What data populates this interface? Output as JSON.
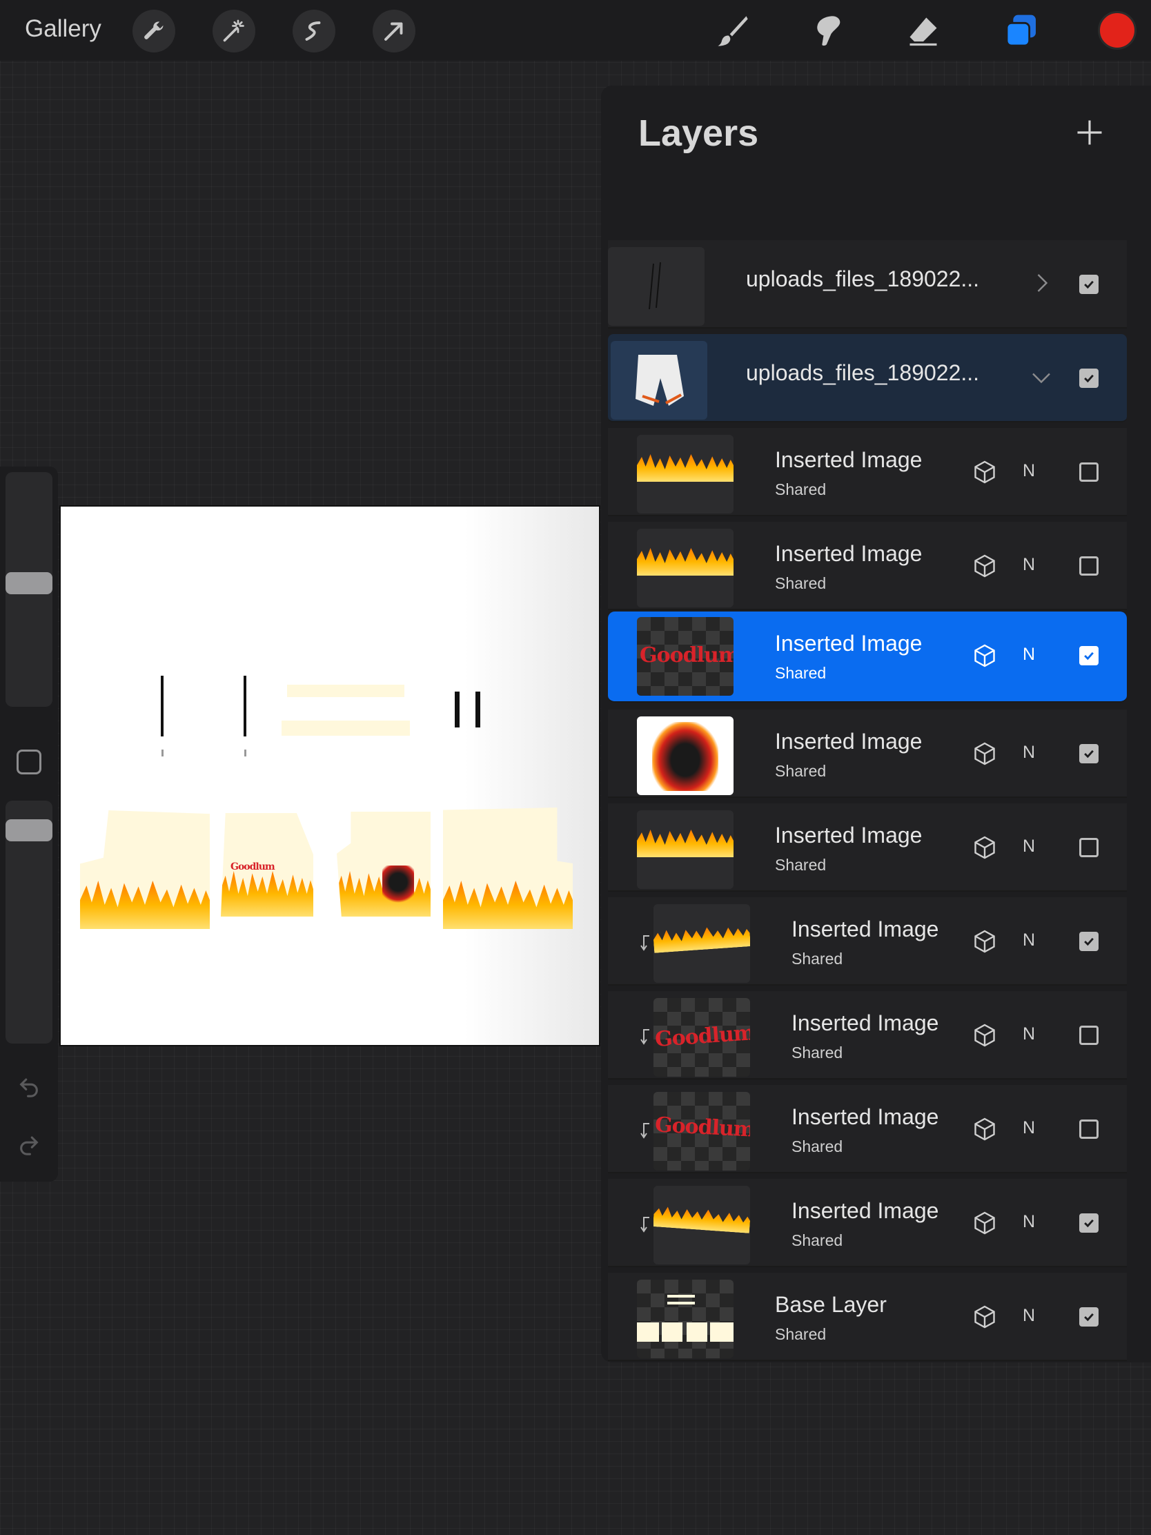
{
  "toolbar": {
    "gallery_label": "Gallery",
    "left_tools": [
      "wrench-icon",
      "magic-wand-icon",
      "selection-icon",
      "transform-arrow-icon"
    ],
    "right_tools": [
      "brush-icon",
      "smudge-icon",
      "eraser-icon",
      "layers-icon"
    ],
    "active_tool": "layers-icon",
    "current_color": "#e2231a",
    "accent": "#0a6cf0"
  },
  "layers_panel": {
    "title": "Layers",
    "add_icon": "plus-icon",
    "layers": [
      {
        "name": "uploads_files_189022...",
        "sub": "",
        "type": "group-collapsed",
        "visible": true
      },
      {
        "name": "uploads_files_189022...",
        "sub": "",
        "type": "group-expanded",
        "visible": true
      },
      {
        "name": "Inserted Image",
        "sub": "Shared",
        "blend": "N",
        "visible": false
      },
      {
        "name": "Inserted Image",
        "sub": "Shared",
        "blend": "N",
        "visible": false
      },
      {
        "name": "Inserted Image",
        "sub": "Shared",
        "blend": "N",
        "visible": true,
        "selected": true
      },
      {
        "name": "Inserted Image",
        "sub": "Shared",
        "blend": "N",
        "visible": true
      },
      {
        "name": "Inserted Image",
        "sub": "Shared",
        "blend": "N",
        "visible": false
      },
      {
        "name": "Inserted Image",
        "sub": "Shared",
        "blend": "N",
        "visible": true,
        "clipped": true
      },
      {
        "name": "Inserted Image",
        "sub": "Shared",
        "blend": "N",
        "visible": false,
        "clipped": true
      },
      {
        "name": "Inserted Image",
        "sub": "Shared",
        "blend": "N",
        "visible": false,
        "clipped": true
      },
      {
        "name": "Inserted Image",
        "sub": "Shared",
        "blend": "N",
        "visible": true,
        "clipped": true
      },
      {
        "name": "Base Layer",
        "sub": "Shared",
        "blend": "N",
        "visible": true
      }
    ]
  },
  "canvas": {
    "logo_text": "Goodlum"
  }
}
